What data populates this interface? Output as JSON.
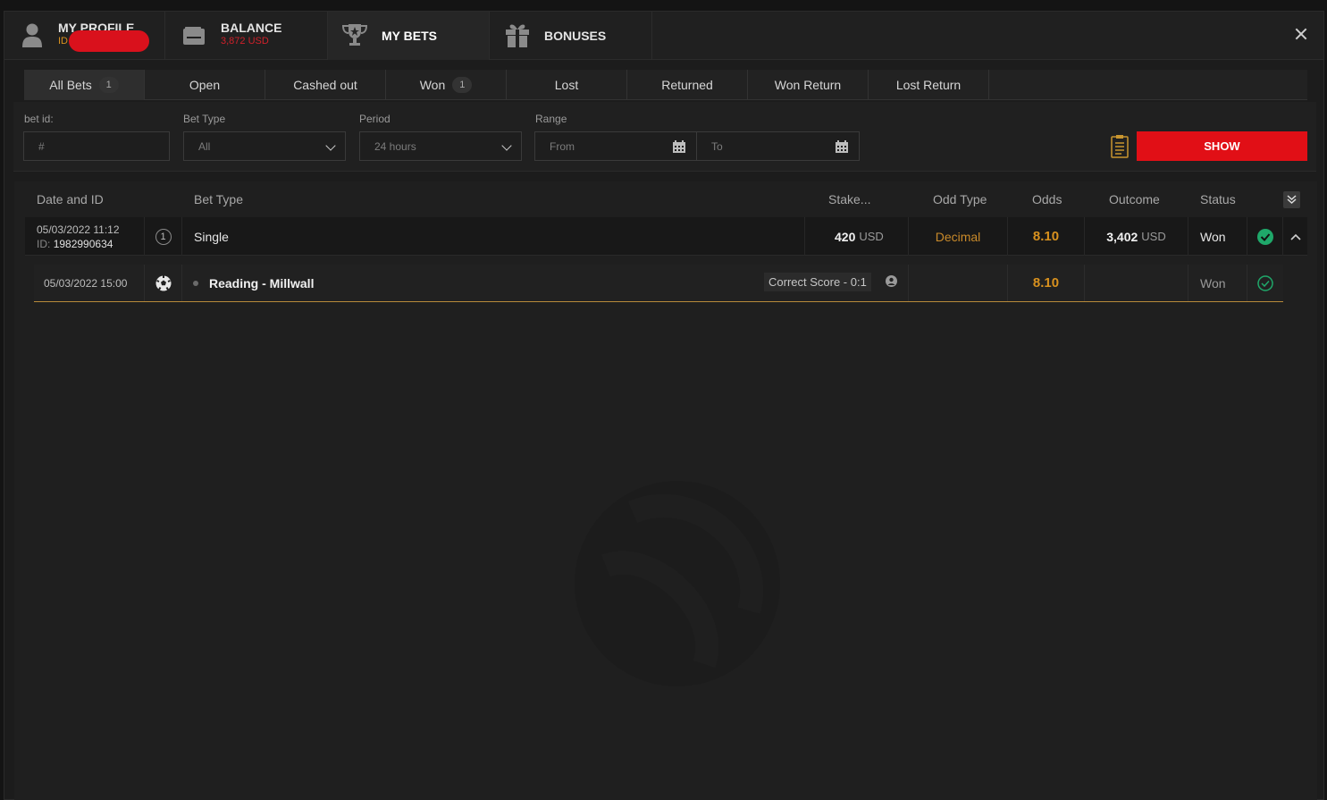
{
  "header": {
    "profile": {
      "title": "MY PROFILE",
      "id_label": "ID"
    },
    "balance": {
      "title": "BALANCE",
      "amount": "3,872 USD"
    },
    "my_bets": {
      "title": "MY BETS"
    },
    "bonuses": {
      "title": "BONUSES"
    }
  },
  "subtabs": [
    {
      "label": "All Bets",
      "count": "1"
    },
    {
      "label": "Open"
    },
    {
      "label": "Cashed out"
    },
    {
      "label": "Won",
      "count": "1"
    },
    {
      "label": "Lost"
    },
    {
      "label": "Returned"
    },
    {
      "label": "Won Return"
    },
    {
      "label": "Lost Return"
    }
  ],
  "filters": {
    "bet_id": {
      "label": "bet id:",
      "placeholder": "#"
    },
    "bet_type": {
      "label": "Bet Type",
      "value": "All"
    },
    "period": {
      "label": "Period",
      "value": "24 hours"
    },
    "range": {
      "label": "Range",
      "from": "From",
      "to": "To"
    },
    "show_label": "SHOW"
  },
  "table": {
    "headers": {
      "date_id": "Date and ID",
      "bet_type": "Bet Type",
      "stake": "Stake...",
      "odd_type": "Odd Type",
      "odds": "Odds",
      "outcome": "Outcome",
      "status": "Status"
    },
    "bet": {
      "datetime": "05/03/2022 11:12",
      "id_label": "ID:",
      "id": "1982990634",
      "events_count": "1",
      "type": "Single",
      "stake": "420",
      "stake_currency": "USD",
      "odd_type": "Decimal",
      "odds": "8.10",
      "outcome": "3,402",
      "outcome_currency": "USD",
      "status": "Won"
    },
    "selection": {
      "datetime": "05/03/2022 15:00",
      "event": "Reading - Millwall",
      "market": "Correct Score - 0:1",
      "odds": "8.10",
      "status": "Won"
    }
  },
  "colors": {
    "accent_red": "#e10f16",
    "odds_orange": "#d8911e",
    "won_green": "#1fa86a"
  }
}
